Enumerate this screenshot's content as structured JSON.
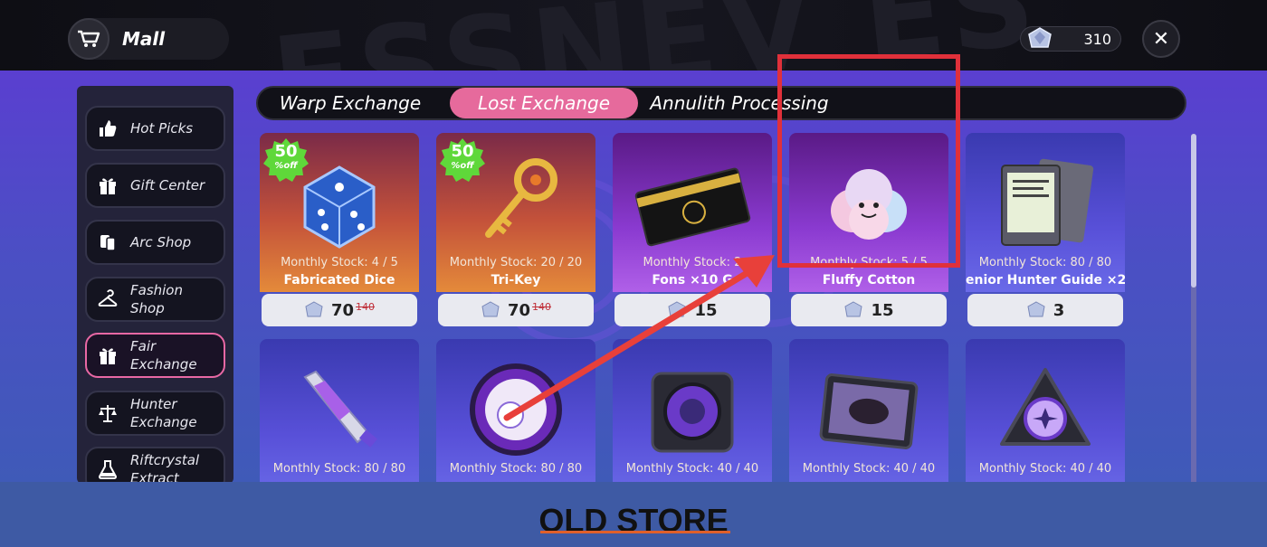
{
  "header": {
    "title": "Mall",
    "currency_value": "310",
    "close_label": "✕"
  },
  "sidebar": {
    "items": [
      {
        "label": "Hot Picks",
        "icon": "thumbs-up-icon"
      },
      {
        "label": "Gift Center",
        "icon": "gift-icon"
      },
      {
        "label": "Arc Shop",
        "icon": "cards-icon"
      },
      {
        "label": "Fashion\nShop",
        "icon": "hanger-icon"
      },
      {
        "label": "Fair\nExchange",
        "icon": "gift-icon",
        "active": true
      },
      {
        "label": "Hunter\nExchange",
        "icon": "scales-icon"
      },
      {
        "label": "Riftcrystal\nExtract",
        "icon": "flask-icon"
      }
    ]
  },
  "tabs": [
    {
      "label": "Warp Exchange"
    },
    {
      "label": "Lost Exchange",
      "active": true
    },
    {
      "label": "Annulith Processing"
    }
  ],
  "cards": [
    {
      "stock": "Monthly Stock:  4 / 5",
      "name": "Fabricated Dice",
      "price": "70",
      "old_price": "140",
      "badge": "50",
      "badge_sub": "%off"
    },
    {
      "stock": "Monthly Stock:  20 / 20",
      "name": "Tri-Key",
      "price": "70",
      "old_price": "140",
      "badge": "50",
      "badge_sub": "%off"
    },
    {
      "stock": "Monthly Stock:  2",
      "name": "Fons ×10 G",
      "price": "15"
    },
    {
      "stock": "Monthly Stock:  5 / 5",
      "name": "Fluffy Cotton",
      "price": "15"
    },
    {
      "stock": "Monthly Stock:  80 / 80",
      "name": "enior Hunter Guide ×2",
      "price": "3"
    },
    {
      "stock": "Monthly Stock:  80 / 80"
    },
    {
      "stock": "Monthly Stock:  80 / 80"
    },
    {
      "stock": "Monthly Stock:  40 / 40"
    },
    {
      "stock": "Monthly Stock:  40 / 40"
    },
    {
      "stock": "Monthly Stock:  40 / 40"
    }
  ],
  "footer": {
    "title": "OLD STORE"
  },
  "colors": {
    "highlight": "#e0303a",
    "active_tab": "#e66a9c",
    "badge": "#5fd83a"
  }
}
